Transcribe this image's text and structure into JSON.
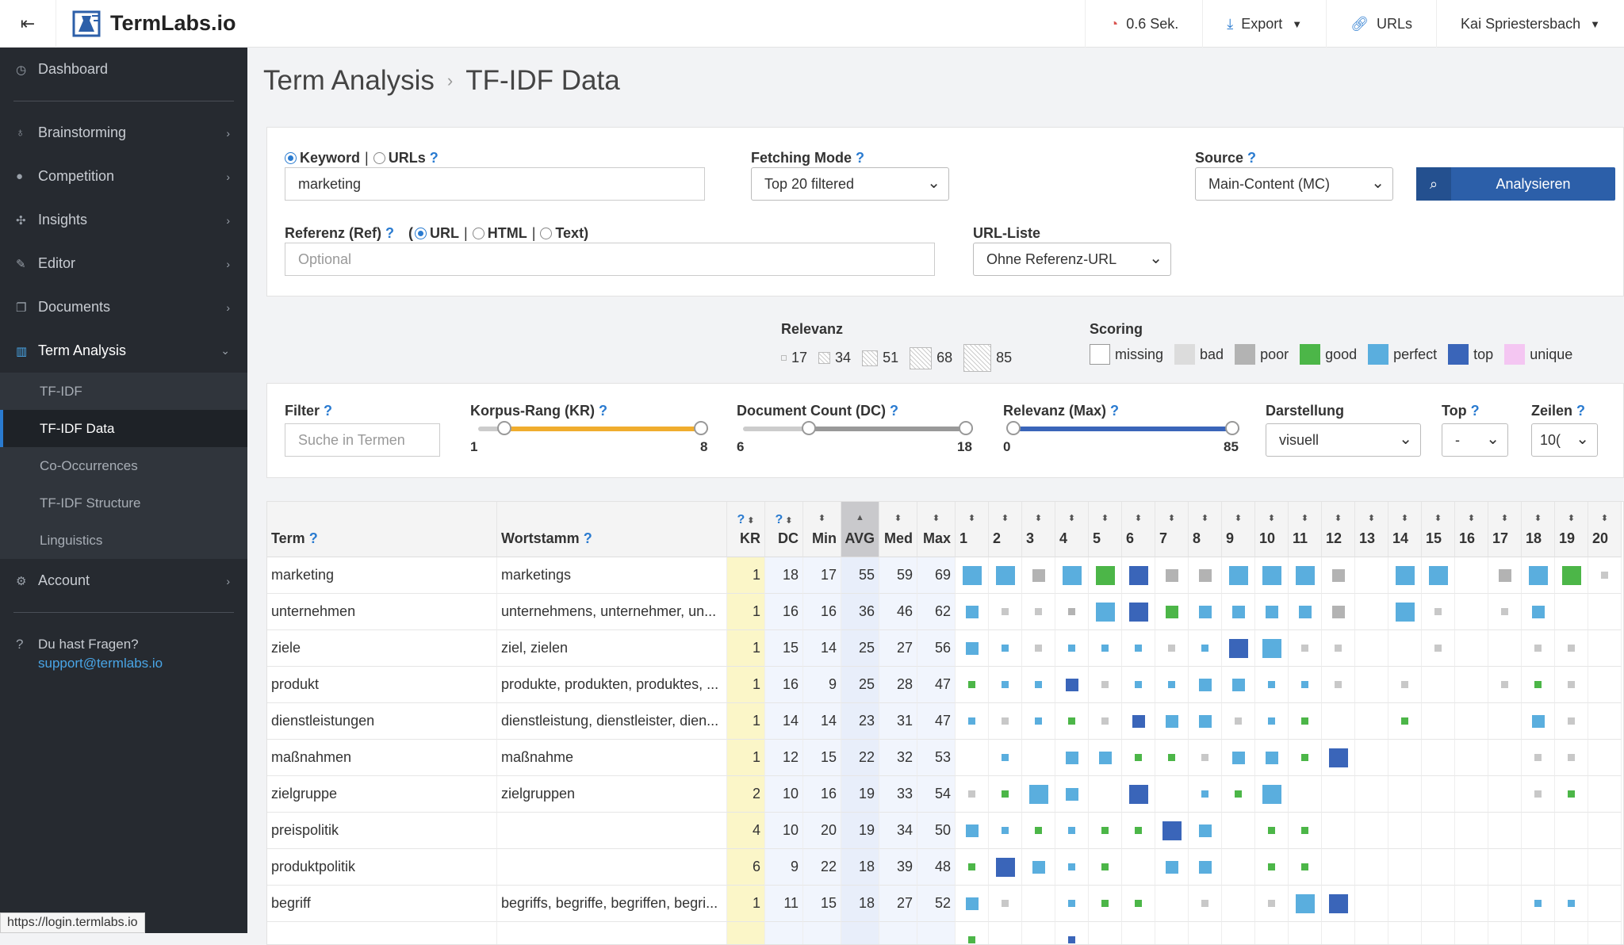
{
  "app": {
    "name": "TermLabs.io"
  },
  "topbar": {
    "timing": "0.6 Sek.",
    "export": "Export",
    "urls": "URLs",
    "user": "Kai Spriestersbach"
  },
  "sidebar": {
    "items": [
      {
        "label": "Dashboard",
        "icon": "dashboard-icon"
      },
      {
        "label": "Brainstorming",
        "icon": "lightbulb-icon"
      },
      {
        "label": "Competition",
        "icon": "globe-icon"
      },
      {
        "label": "Insights",
        "icon": "crosshair-icon"
      },
      {
        "label": "Editor",
        "icon": "pencil-icon"
      },
      {
        "label": "Documents",
        "icon": "documents-icon"
      },
      {
        "label": "Term Analysis",
        "icon": "bar-chart-icon"
      },
      {
        "label": "Account",
        "icon": "gears-icon"
      }
    ],
    "sub": [
      "TF-IDF",
      "TF-IDF Data",
      "Co-Occurrences",
      "TF-IDF Structure",
      "Linguistics"
    ],
    "help": {
      "q": "Du hast Fragen?",
      "email": "support@termlabs.io"
    }
  },
  "status_url": "https://login.termlabs.io",
  "breadcrumb": {
    "parent": "Term Analysis",
    "current": "TF-IDF Data"
  },
  "form": {
    "keyword_label": "Keyword",
    "urls_label": "URLs",
    "keyword_value": "marketing",
    "fetch_label": "Fetching Mode",
    "fetch_value": "Top 20 filtered",
    "source_label": "Source",
    "source_value": "Main-Content (MC)",
    "analyze": "Analysieren",
    "ref_label": "Referenz (Ref)",
    "ref_url": "URL",
    "ref_html": "HTML",
    "ref_text": "Text",
    "ref_placeholder": "Optional",
    "urllist_label": "URL-Liste",
    "urllist_value": "Ohne Referenz-URL"
  },
  "legend": {
    "relevanz": "Relevanz",
    "rel_values": [
      "17",
      "34",
      "51",
      "68",
      "85"
    ],
    "scoring": "Scoring",
    "scores": [
      {
        "label": "missing",
        "color": "#ffffff"
      },
      {
        "label": "bad",
        "color": "#dcdcdc"
      },
      {
        "label": "poor",
        "color": "#b3b3b3"
      },
      {
        "label": "good",
        "color": "#4cb648"
      },
      {
        "label": "perfect",
        "color": "#5aaede"
      },
      {
        "label": "top",
        "color": "#3a65b9"
      },
      {
        "label": "unique",
        "color": "#f4c6f2"
      }
    ]
  },
  "filters": {
    "filter_label": "Filter",
    "filter_placeholder": "Suche in Termen",
    "kr_label": "Korpus-Rang (KR)",
    "kr_min": "1",
    "kr_max": "8",
    "dc_label": "Document Count (DC)",
    "dc_min": "6",
    "dc_max": "18",
    "rel_label": "Relevanz (Max)",
    "rel_min": "0",
    "rel_max": "85",
    "darst_label": "Darstellung",
    "darst_value": "visuell",
    "top_label": "Top",
    "top_value": "-",
    "zeilen_label": "Zeilen",
    "zeilen_value": "10("
  },
  "table": {
    "headers": {
      "term": "Term",
      "stem": "Wortstamm",
      "kr": "KR",
      "dc": "DC",
      "min": "Min",
      "avg": "AVG",
      "med": "Med",
      "max": "Max"
    },
    "docs": [
      "1",
      "2",
      "3",
      "4",
      "5",
      "6",
      "7",
      "8",
      "9",
      "10",
      "11",
      "12",
      "13",
      "14",
      "15",
      "16",
      "17",
      "18",
      "19",
      "20"
    ],
    "rows": [
      {
        "term": "marketing",
        "stem": "marketings",
        "kr": "1",
        "dc": "18",
        "min": "17",
        "avg": "55",
        "med": "59",
        "max": "69",
        "cells": [
          "pL",
          "pL",
          "oM",
          "pL",
          "gL",
          "tL",
          "oM",
          "oM",
          "pL",
          "pL",
          "pL",
          "oM",
          "",
          "pL",
          "pL",
          "",
          "oM",
          "pL",
          "gL",
          "bS"
        ]
      },
      {
        "term": "unternehmen",
        "stem": "unternehmens, unternehmer, un...",
        "kr": "1",
        "dc": "16",
        "min": "16",
        "avg": "36",
        "med": "46",
        "max": "62",
        "cells": [
          "pM",
          "bS",
          "bS",
          "oS",
          "pL",
          "tL",
          "gM",
          "pM",
          "pM",
          "pM",
          "pM",
          "oM",
          "",
          "pL",
          "bS",
          "",
          "bS",
          "pM",
          "",
          ""
        ]
      },
      {
        "term": "ziele",
        "stem": "ziel, zielen",
        "kr": "1",
        "dc": "15",
        "min": "14",
        "avg": "25",
        "med": "27",
        "max": "56",
        "cells": [
          "pM",
          "pS",
          "bS",
          "pS",
          "pS",
          "pS",
          "bS",
          "pS",
          "tL",
          "pL",
          "bS",
          "bS",
          "",
          "",
          "bS",
          "",
          "",
          "bS",
          "bS",
          ""
        ]
      },
      {
        "term": "produkt",
        "stem": "produkte, produkten, produktes, ...",
        "kr": "1",
        "dc": "16",
        "min": "9",
        "avg": "25",
        "med": "28",
        "max": "47",
        "cells": [
          "gS",
          "pS",
          "pS",
          "tM",
          "bS",
          "pS",
          "pS",
          "pM",
          "pM",
          "pS",
          "pS",
          "bS",
          "",
          "bS",
          "",
          "",
          "bS",
          "gS",
          "bS",
          ""
        ]
      },
      {
        "term": "dienstleistungen",
        "stem": "dienstleistung, dienstleister, dien...",
        "kr": "1",
        "dc": "14",
        "min": "14",
        "avg": "23",
        "med": "31",
        "max": "47",
        "cells": [
          "pS",
          "bS",
          "pS",
          "gS",
          "bS",
          "tM",
          "pM",
          "pM",
          "bS",
          "pS",
          "gS",
          "",
          "",
          "gS",
          "",
          "",
          "",
          "pM",
          "bS",
          ""
        ]
      },
      {
        "term": "maßnahmen",
        "stem": "maßnahme",
        "kr": "1",
        "dc": "12",
        "min": "15",
        "avg": "22",
        "med": "32",
        "max": "53",
        "cells": [
          "",
          "pS",
          "",
          "pM",
          "pM",
          "gS",
          "gS",
          "bS",
          "pM",
          "pM",
          "gS",
          "tL",
          "",
          "",
          "",
          "",
          "",
          "bS",
          "bS",
          ""
        ]
      },
      {
        "term": "zielgruppe",
        "stem": "zielgruppen",
        "kr": "2",
        "dc": "10",
        "min": "16",
        "avg": "19",
        "med": "33",
        "max": "54",
        "cells": [
          "bS",
          "gS",
          "pL",
          "pM",
          "",
          "tL",
          "",
          "pS",
          "gS",
          "pL",
          "",
          "",
          "",
          "",
          "",
          "",
          "",
          "bS",
          "gS",
          ""
        ]
      },
      {
        "term": "preispolitik",
        "stem": "",
        "kr": "4",
        "dc": "10",
        "min": "20",
        "avg": "19",
        "med": "34",
        "max": "50",
        "cells": [
          "pM",
          "pS",
          "gS",
          "pS",
          "gS",
          "gS",
          "tL",
          "pM",
          "",
          "gS",
          "gS",
          "",
          "",
          "",
          "",
          "",
          "",
          "",
          "",
          ""
        ]
      },
      {
        "term": "produktpolitik",
        "stem": "",
        "kr": "6",
        "dc": "9",
        "min": "22",
        "avg": "18",
        "med": "39",
        "max": "48",
        "cells": [
          "gS",
          "tL",
          "pM",
          "pS",
          "gS",
          "",
          "pM",
          "pM",
          "",
          "gS",
          "gS",
          "",
          "",
          "",
          "",
          "",
          "",
          "",
          "",
          ""
        ]
      },
      {
        "term": "begriff",
        "stem": "begriffs, begriffe, begriffen, begri...",
        "kr": "1",
        "dc": "11",
        "min": "15",
        "avg": "18",
        "med": "27",
        "max": "52",
        "cells": [
          "pM",
          "bS",
          "",
          "pS",
          "gS",
          "gS",
          "",
          "bS",
          "",
          "bS",
          "pL",
          "tL",
          "",
          "",
          "",
          "",
          "",
          "pS",
          "pS",
          ""
        ]
      },
      {
        "term": "",
        "stem": "",
        "kr": "",
        "dc": "",
        "min": "",
        "avg": "",
        "med": "",
        "max": "",
        "cells": [
          "gS",
          "",
          "",
          "tS",
          "",
          "",
          "",
          "",
          "",
          "",
          "",
          "",
          "",
          "",
          "",
          "",
          "",
          "",
          "",
          ""
        ]
      }
    ]
  }
}
